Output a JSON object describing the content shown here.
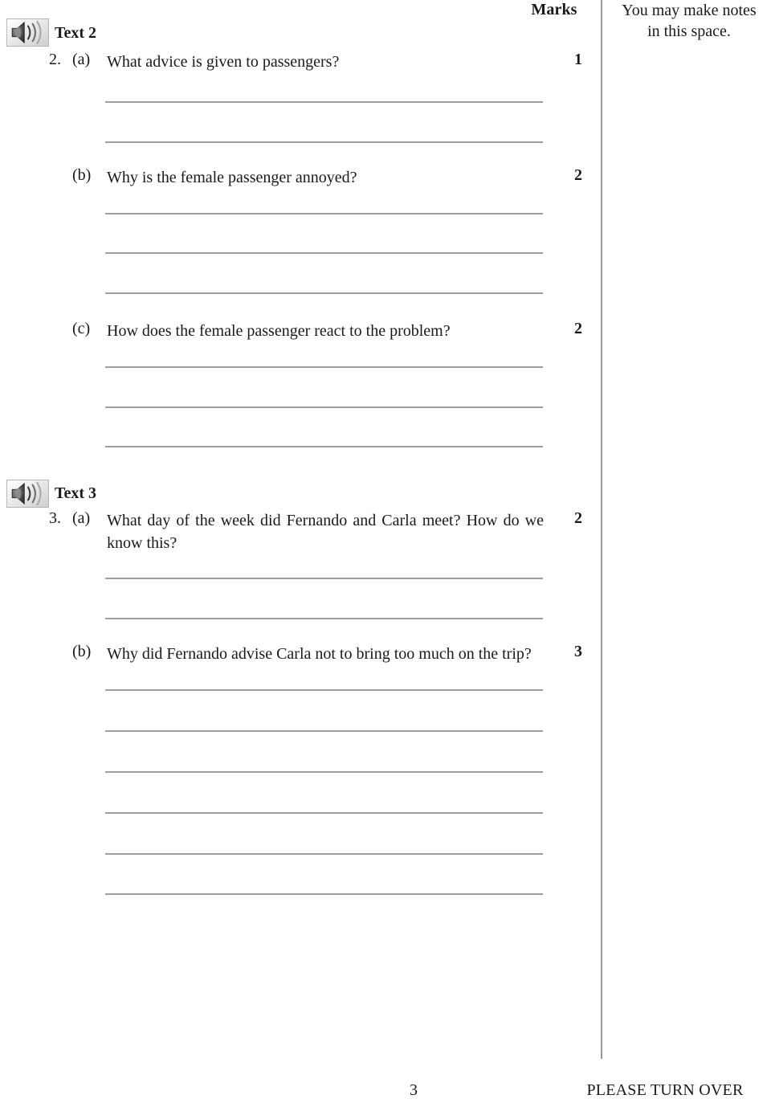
{
  "header": {
    "marks_label": "Marks",
    "notes_line1": "You may make notes",
    "notes_line2": "in this space."
  },
  "sections": [
    {
      "heading": "Text 2",
      "icon": "speaker-icon",
      "number": "2.",
      "questions": [
        {
          "letter": "(a)",
          "text": "What advice is given to passengers?",
          "marks": "1",
          "lines": 2
        },
        {
          "letter": "(b)",
          "text": "Why is the female passenger annoyed?",
          "marks": "2",
          "lines": 3
        },
        {
          "letter": "(c)",
          "text": "How does the female passenger react to the problem?",
          "marks": "2",
          "lines": 3
        }
      ]
    },
    {
      "heading": "Text 3",
      "icon": "speaker-icon",
      "number": "3.",
      "questions": [
        {
          "letter": "(a)",
          "text": "What day of the week did Fernando and Carla meet? How do we know this?",
          "marks": "2",
          "lines": 2
        },
        {
          "letter": "(b)",
          "text": "Why did Fernando advise Carla not to bring too much on the trip?",
          "marks": "3",
          "lines": 6
        }
      ]
    }
  ],
  "footer": {
    "page_number": "3",
    "turn_over": "PLEASE TURN OVER"
  },
  "colors": {
    "rule_line": "#9d9d9d",
    "divider": "#9a9a9a",
    "text": "#1a1a1a"
  }
}
